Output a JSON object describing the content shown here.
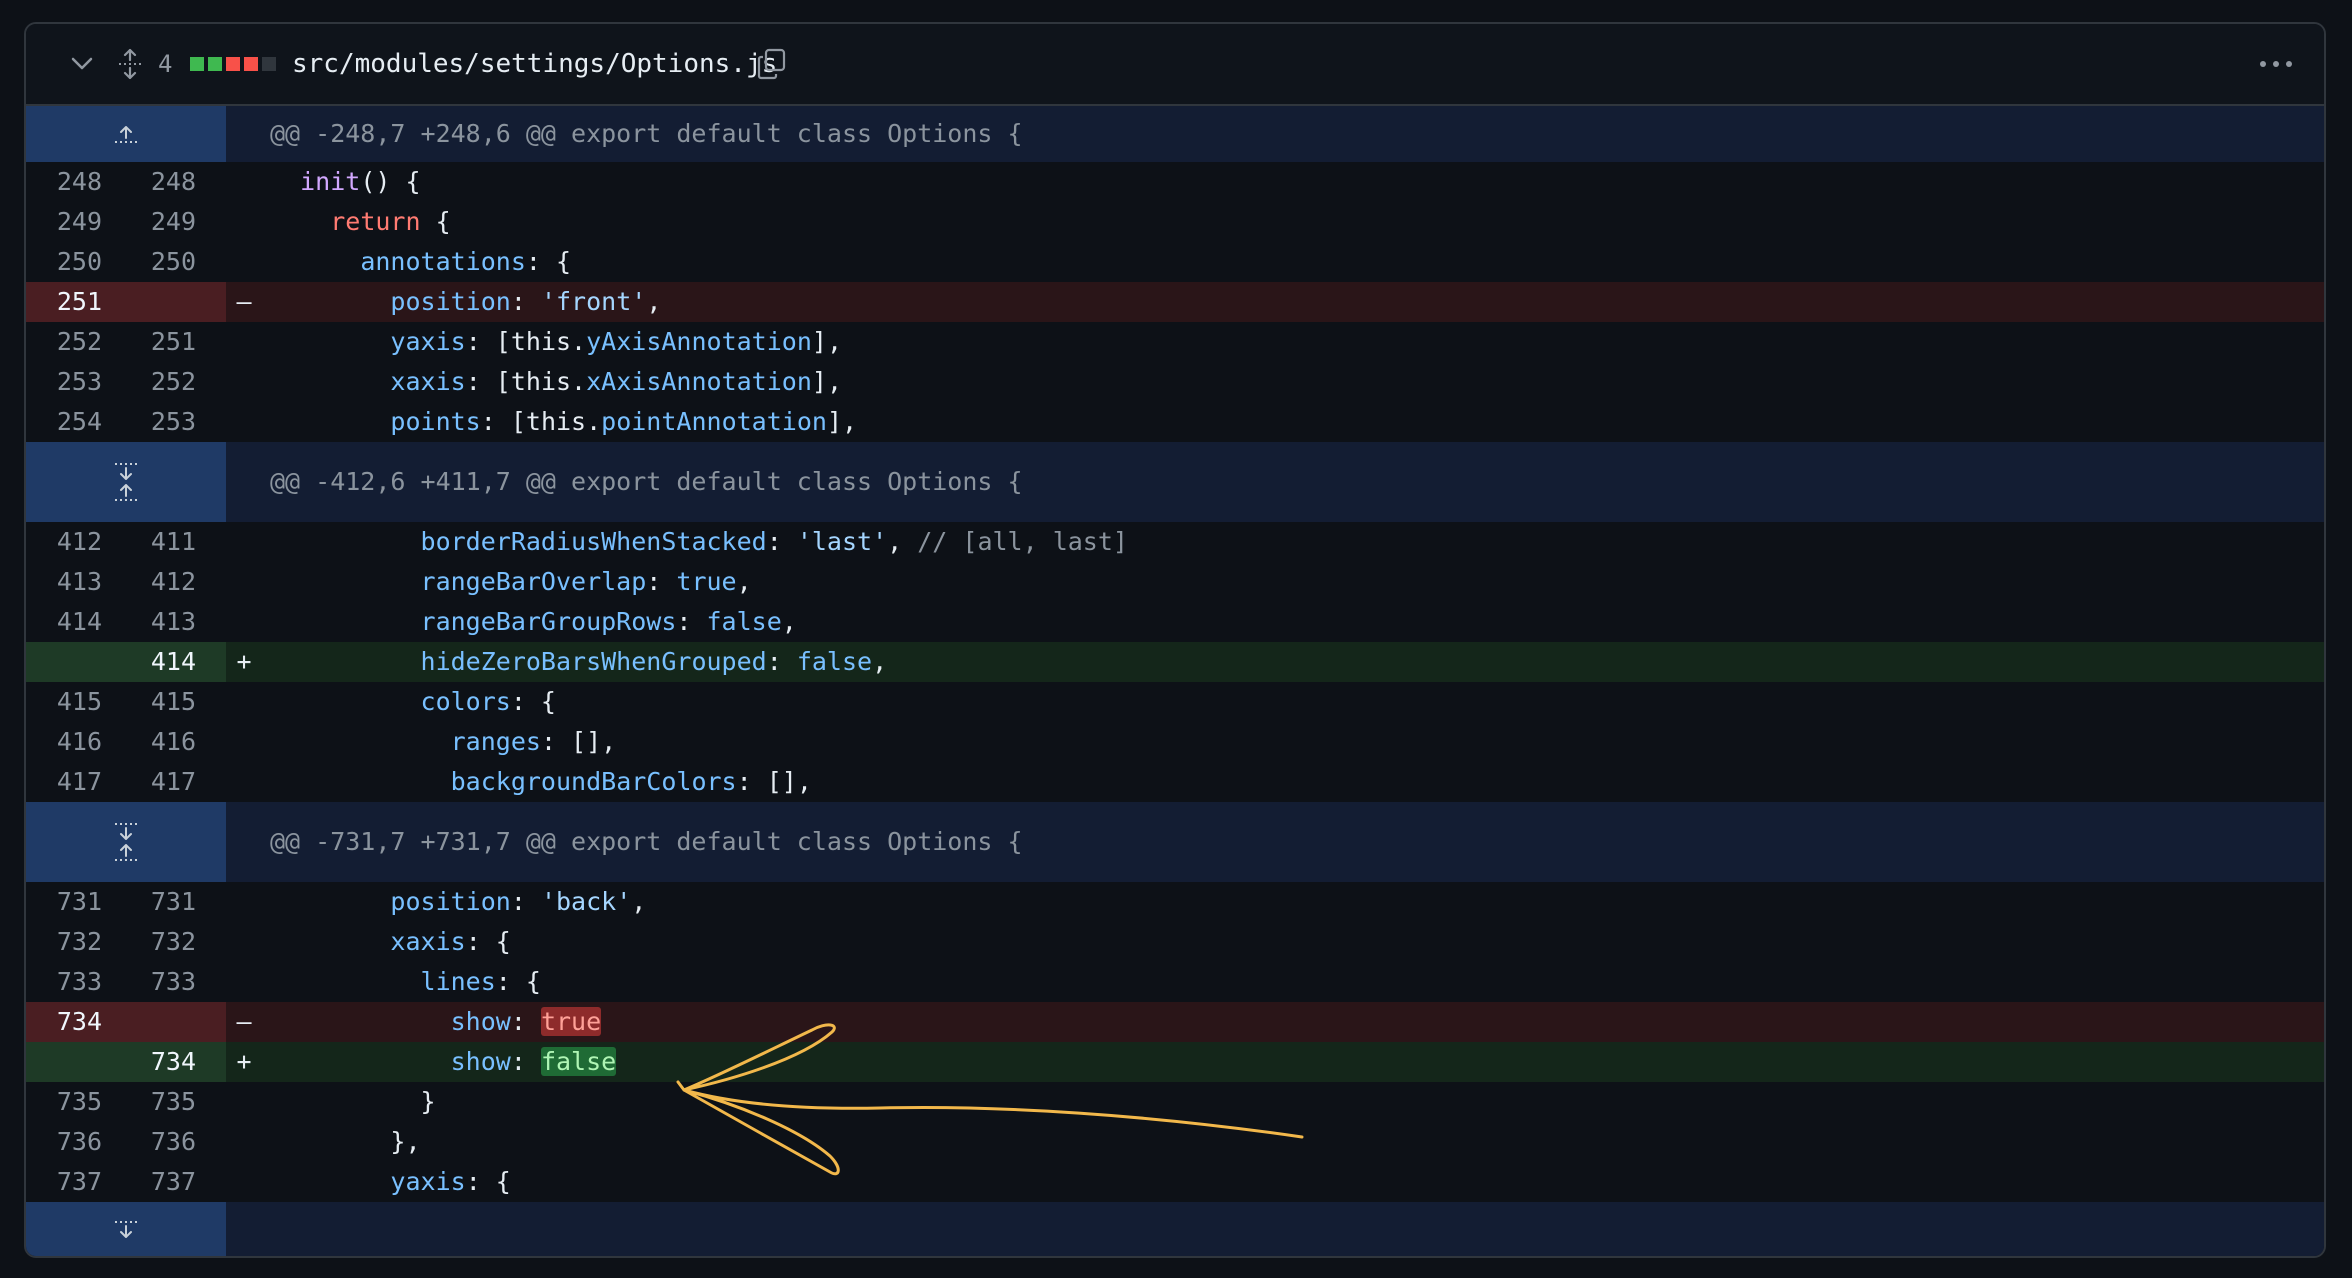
{
  "file": {
    "changes_count": "4",
    "path": "src/modules/settings/Options.js",
    "diffstat_colors": [
      "#3fb950",
      "#3fb950",
      "#f85149",
      "#f85149",
      "#30363d"
    ]
  },
  "colors": {
    "addition": "#3fb950",
    "deletion": "#f85149",
    "annotation_stroke": "#f2b84b"
  },
  "hunks": [
    {
      "header": "@@ -248,7 +248,6 @@ export default class Options {",
      "expand": "up",
      "lines": [
        {
          "type": "ctx",
          "old": "248",
          "new": "248",
          "indent": "  ",
          "tokens": [
            [
              "fn",
              "init"
            ],
            [
              "pl",
              "() {"
            ]
          ]
        },
        {
          "type": "ctx",
          "old": "249",
          "new": "249",
          "indent": "    ",
          "tokens": [
            [
              "kw",
              "return"
            ],
            [
              "pl",
              " {"
            ]
          ]
        },
        {
          "type": "ctx",
          "old": "250",
          "new": "250",
          "indent": "      ",
          "tokens": [
            [
              "prop",
              "annotations"
            ],
            [
              "pl",
              ": {"
            ]
          ]
        },
        {
          "type": "del",
          "old": "251",
          "new": "",
          "sign": "–",
          "indent": "        ",
          "tokens": [
            [
              "prop",
              "position"
            ],
            [
              "pl",
              ": "
            ],
            [
              "str",
              "'front'"
            ],
            [
              "pl",
              ","
            ]
          ]
        },
        {
          "type": "ctx",
          "old": "252",
          "new": "251",
          "indent": "        ",
          "tokens": [
            [
              "prop",
              "yaxis"
            ],
            [
              "pl",
              ": [this."
            ],
            [
              "prop",
              "yAxisAnnotation"
            ],
            [
              "pl",
              "],"
            ]
          ]
        },
        {
          "type": "ctx",
          "old": "253",
          "new": "252",
          "indent": "        ",
          "tokens": [
            [
              "prop",
              "xaxis"
            ],
            [
              "pl",
              ": [this."
            ],
            [
              "prop",
              "xAxisAnnotation"
            ],
            [
              "pl",
              "],"
            ]
          ]
        },
        {
          "type": "ctx",
          "old": "254",
          "new": "253",
          "indent": "        ",
          "tokens": [
            [
              "prop",
              "points"
            ],
            [
              "pl",
              ": [this."
            ],
            [
              "prop",
              "pointAnnotation"
            ],
            [
              "pl",
              "],"
            ]
          ]
        }
      ]
    },
    {
      "header": "@@ -412,6 +411,7 @@ export default class Options {",
      "expand": "both",
      "lines": [
        {
          "type": "ctx",
          "old": "412",
          "new": "411",
          "indent": "          ",
          "tokens": [
            [
              "prop",
              "borderRadiusWhenStacked"
            ],
            [
              "pl",
              ": "
            ],
            [
              "str",
              "'last'"
            ],
            [
              "pl",
              ", "
            ],
            [
              "cmt",
              "// [all, last]"
            ]
          ]
        },
        {
          "type": "ctx",
          "old": "413",
          "new": "412",
          "indent": "          ",
          "tokens": [
            [
              "prop",
              "rangeBarOverlap"
            ],
            [
              "pl",
              ": "
            ],
            [
              "bool",
              "true"
            ],
            [
              "pl",
              ","
            ]
          ]
        },
        {
          "type": "ctx",
          "old": "414",
          "new": "413",
          "indent": "          ",
          "tokens": [
            [
              "prop",
              "rangeBarGroupRows"
            ],
            [
              "pl",
              ": "
            ],
            [
              "bool",
              "false"
            ],
            [
              "pl",
              ","
            ]
          ]
        },
        {
          "type": "add",
          "old": "",
          "new": "414",
          "sign": "+",
          "indent": "          ",
          "tokens": [
            [
              "prop",
              "hideZeroBarsWhenGrouped"
            ],
            [
              "pl",
              ": "
            ],
            [
              "bool",
              "false"
            ],
            [
              "pl",
              ","
            ]
          ]
        },
        {
          "type": "ctx",
          "old": "415",
          "new": "415",
          "indent": "          ",
          "tokens": [
            [
              "prop",
              "colors"
            ],
            [
              "pl",
              ": {"
            ]
          ]
        },
        {
          "type": "ctx",
          "old": "416",
          "new": "416",
          "indent": "            ",
          "tokens": [
            [
              "prop",
              "ranges"
            ],
            [
              "pl",
              ": [],"
            ]
          ]
        },
        {
          "type": "ctx",
          "old": "417",
          "new": "417",
          "indent": "            ",
          "tokens": [
            [
              "prop",
              "backgroundBarColors"
            ],
            [
              "pl",
              ": [],"
            ]
          ]
        }
      ]
    },
    {
      "header": "@@ -731,7 +731,7 @@ export default class Options {",
      "expand": "both",
      "lines": [
        {
          "type": "ctx",
          "old": "731",
          "new": "731",
          "indent": "        ",
          "tokens": [
            [
              "prop",
              "position"
            ],
            [
              "pl",
              ": "
            ],
            [
              "str",
              "'back'"
            ],
            [
              "pl",
              ","
            ]
          ]
        },
        {
          "type": "ctx",
          "old": "732",
          "new": "732",
          "indent": "        ",
          "tokens": [
            [
              "prop",
              "xaxis"
            ],
            [
              "pl",
              ": {"
            ]
          ]
        },
        {
          "type": "ctx",
          "old": "733",
          "new": "733",
          "indent": "          ",
          "tokens": [
            [
              "prop",
              "lines"
            ],
            [
              "pl",
              ": {"
            ]
          ]
        },
        {
          "type": "del",
          "old": "734",
          "new": "",
          "sign": "–",
          "indent": "            ",
          "tokens": [
            [
              "prop",
              "show"
            ],
            [
              "pl",
              ": "
            ],
            [
              "hl-del",
              "true"
            ]
          ]
        },
        {
          "type": "add",
          "old": "",
          "new": "734",
          "sign": "+",
          "indent": "            ",
          "tokens": [
            [
              "prop",
              "show"
            ],
            [
              "pl",
              ": "
            ],
            [
              "hl-add",
              "false"
            ]
          ]
        },
        {
          "type": "ctx",
          "old": "735",
          "new": "735",
          "indent": "          ",
          "tokens": [
            [
              "pl",
              "}"
            ]
          ]
        },
        {
          "type": "ctx",
          "old": "736",
          "new": "736",
          "indent": "        ",
          "tokens": [
            [
              "pl",
              "},"
            ]
          ]
        },
        {
          "type": "ctx",
          "old": "737",
          "new": "737",
          "indent": "        ",
          "tokens": [
            [
              "prop",
              "yaxis"
            ],
            [
              "pl",
              ": {"
            ]
          ]
        }
      ]
    }
  ],
  "footer_expand": "down"
}
